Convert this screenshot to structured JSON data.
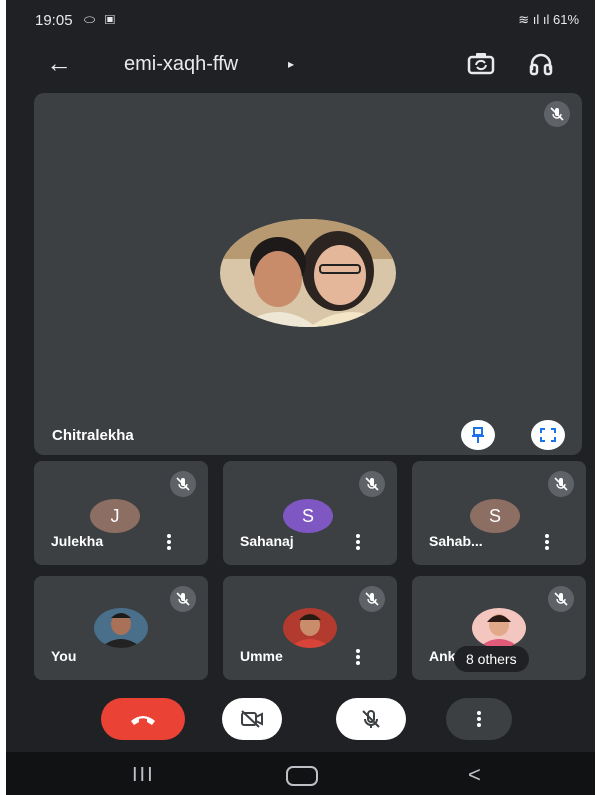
{
  "status_bar": {
    "time": "19:05",
    "left_icons": "⬭ ▣",
    "right_icons": "≋ ıl ıl 61%"
  },
  "header": {
    "meeting_code": "emi-xaqh-ffw",
    "caret": "▸",
    "back_glyph": "←",
    "icons": [
      "arrow-back-icon",
      "switch-camera-icon",
      "headset-icon"
    ]
  },
  "main_speaker": {
    "name": "Chitralekha",
    "muted": true
  },
  "participants": [
    {
      "name": "Julekha",
      "initial": "J",
      "avatar_color": "#8d6e63",
      "muted": true
    },
    {
      "name": "Sahanaj",
      "initial": "S",
      "avatar_color": "#7e57c2",
      "muted": true
    },
    {
      "name": "Sahab...",
      "initial": "S",
      "avatar_color": "#8d6e63",
      "muted": true
    },
    {
      "name": "You",
      "muted": true
    },
    {
      "name": "Umme",
      "muted": true
    },
    {
      "name": "Ank",
      "muted": true,
      "others_label": "8 others"
    }
  ],
  "controls": [
    "end-call-icon",
    "camera-off-icon",
    "mic-off-icon",
    "more-options-icon"
  ],
  "navbar": {
    "recents_glyph": "III",
    "back_glyph": "<"
  },
  "colors": {
    "background": "#202124",
    "tile": "#3c4043",
    "end_call": "#ea4335",
    "mute_badge": "#5f6368"
  }
}
